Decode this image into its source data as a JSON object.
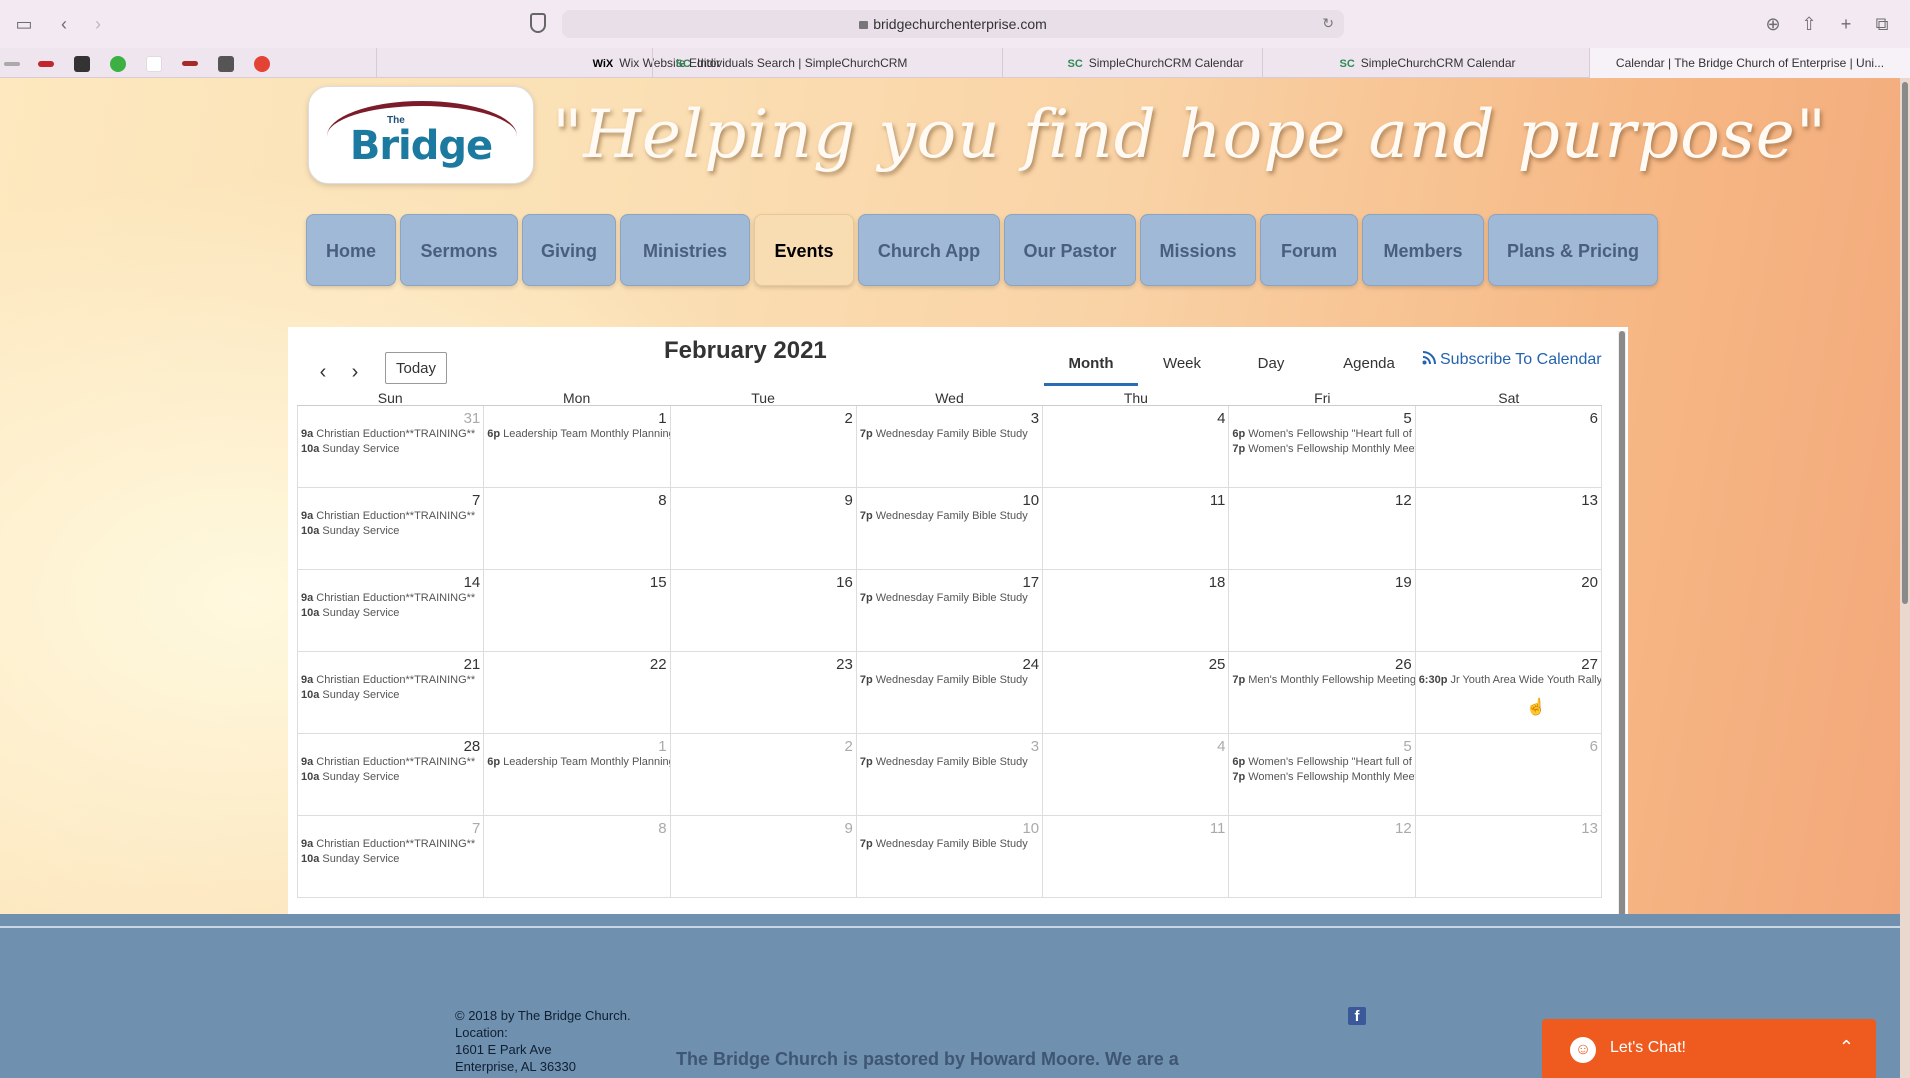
{
  "browser": {
    "url": "bridgechurchenterprise.com",
    "tabs": [
      {
        "label": "Wix Website Editor",
        "fav": "WiX",
        "fav_color": "#000000"
      },
      {
        "label": "Individuals Search | SimpleChurchCRM",
        "fav": "SC",
        "fav_color": "#2e8b57"
      },
      {
        "label": "SimpleChurchCRM Calendar",
        "fav": "SC",
        "fav_color": "#2e8b57"
      },
      {
        "label": "SimpleChurchCRM Calendar",
        "fav": "SC",
        "fav_color": "#2e8b57"
      },
      {
        "label": "Calendar | The Bridge Church of Enterprise | Uni...",
        "fav": "",
        "fav_color": "#000000"
      }
    ]
  },
  "site": {
    "logo_the": "The",
    "logo_name": "Bridge",
    "tagline": "\"Helping you find hope and purpose\"",
    "nav": [
      "Home",
      "Sermons",
      "Giving",
      "Ministries",
      "Events",
      "Church App",
      "Our Pastor",
      "Missions",
      "Forum",
      "Members",
      "Plans & Pricing"
    ],
    "active_nav": "Events"
  },
  "calendar": {
    "title": "February 2021",
    "today_label": "Today",
    "views": [
      "Month",
      "Week",
      "Day",
      "Agenda"
    ],
    "active_view": "Month",
    "subscribe_label": "Subscribe To Calendar",
    "weekdays": [
      "Sun",
      "Mon",
      "Tue",
      "Wed",
      "Thu",
      "Fri",
      "Sat"
    ],
    "weeks": [
      [
        {
          "d": "31",
          "other": true,
          "events": [
            {
              "t": "9a",
              "n": "Christian Eduction**TRAINING**"
            },
            {
              "t": "10a",
              "n": "Sunday Service"
            }
          ]
        },
        {
          "d": "1",
          "events": [
            {
              "t": "6p",
              "n": "Leadership Team Monthly Planning"
            }
          ]
        },
        {
          "d": "2",
          "events": []
        },
        {
          "d": "3",
          "events": [
            {
              "t": "7p",
              "n": "Wednesday Family Bible Study"
            }
          ]
        },
        {
          "d": "4",
          "events": []
        },
        {
          "d": "5",
          "events": [
            {
              "t": "6p",
              "n": "Women's Fellowship \"Heart full of"
            },
            {
              "t": "7p",
              "n": "Women's Fellowship Monthly Meeting"
            }
          ]
        },
        {
          "d": "6",
          "events": []
        }
      ],
      [
        {
          "d": "7",
          "events": [
            {
              "t": "9a",
              "n": "Christian Eduction**TRAINING**"
            },
            {
              "t": "10a",
              "n": "Sunday Service"
            }
          ]
        },
        {
          "d": "8",
          "events": []
        },
        {
          "d": "9",
          "events": []
        },
        {
          "d": "10",
          "events": [
            {
              "t": "7p",
              "n": "Wednesday Family Bible Study"
            }
          ]
        },
        {
          "d": "11",
          "events": []
        },
        {
          "d": "12",
          "events": []
        },
        {
          "d": "13",
          "events": []
        }
      ],
      [
        {
          "d": "14",
          "events": [
            {
              "t": "9a",
              "n": "Christian Eduction**TRAINING**"
            },
            {
              "t": "10a",
              "n": "Sunday Service"
            }
          ]
        },
        {
          "d": "15",
          "events": []
        },
        {
          "d": "16",
          "events": []
        },
        {
          "d": "17",
          "events": [
            {
              "t": "7p",
              "n": "Wednesday Family Bible Study"
            }
          ]
        },
        {
          "d": "18",
          "events": []
        },
        {
          "d": "19",
          "events": []
        },
        {
          "d": "20",
          "events": []
        }
      ],
      [
        {
          "d": "21",
          "events": [
            {
              "t": "9a",
              "n": "Christian Eduction**TRAINING**"
            },
            {
              "t": "10a",
              "n": "Sunday Service"
            }
          ]
        },
        {
          "d": "22",
          "events": []
        },
        {
          "d": "23",
          "events": []
        },
        {
          "d": "24",
          "events": [
            {
              "t": "7p",
              "n": "Wednesday Family Bible Study"
            }
          ]
        },
        {
          "d": "25",
          "events": []
        },
        {
          "d": "26",
          "events": [
            {
              "t": "7p",
              "n": "Men's Monthly Fellowship Meeting"
            }
          ]
        },
        {
          "d": "27",
          "events": [
            {
              "t": "6:30p",
              "n": "Jr Youth Area Wide Youth Rally"
            }
          ]
        }
      ],
      [
        {
          "d": "28",
          "events": [
            {
              "t": "9a",
              "n": "Christian Eduction**TRAINING**"
            },
            {
              "t": "10a",
              "n": "Sunday Service"
            }
          ]
        },
        {
          "d": "1",
          "other": true,
          "events": [
            {
              "t": "6p",
              "n": "Leadership Team Monthly Planning"
            }
          ]
        },
        {
          "d": "2",
          "other": true,
          "events": []
        },
        {
          "d": "3",
          "other": true,
          "events": [
            {
              "t": "7p",
              "n": "Wednesday Family Bible Study"
            }
          ]
        },
        {
          "d": "4",
          "other": true,
          "events": []
        },
        {
          "d": "5",
          "other": true,
          "events": [
            {
              "t": "6p",
              "n": "Women's Fellowship \"Heart full of"
            },
            {
              "t": "7p",
              "n": "Women's Fellowship Monthly Meeting"
            }
          ]
        },
        {
          "d": "6",
          "other": true,
          "events": []
        }
      ],
      [
        {
          "d": "7",
          "other": true,
          "events": [
            {
              "t": "9a",
              "n": "Christian Eduction**TRAINING**"
            },
            {
              "t": "10a",
              "n": "Sunday Service"
            }
          ]
        },
        {
          "d": "8",
          "other": true,
          "events": []
        },
        {
          "d": "9",
          "other": true,
          "events": []
        },
        {
          "d": "10",
          "other": true,
          "events": [
            {
              "t": "7p",
              "n": "Wednesday Family Bible Study"
            }
          ]
        },
        {
          "d": "11",
          "other": true,
          "events": []
        },
        {
          "d": "12",
          "other": true,
          "events": []
        },
        {
          "d": "13",
          "other": true,
          "events": []
        }
      ]
    ]
  },
  "footer": {
    "lines": [
      "© 2018 by The Bridge Church.",
      "Location:",
      "1601 E Park Ave",
      "Enterprise, AL 36330"
    ],
    "blurb": "The Bridge Church is pastored by Howard Moore. We are a",
    "fb_label": "f",
    "chat_label": "Let's Chat!"
  },
  "colors": {
    "nav_bg": "#9fb9d6",
    "nav_active_bg": "#f8dcb2",
    "accent": "#2b6db5",
    "chat_bg": "#ef5a1f",
    "footer_bg": "#6f90ae"
  }
}
